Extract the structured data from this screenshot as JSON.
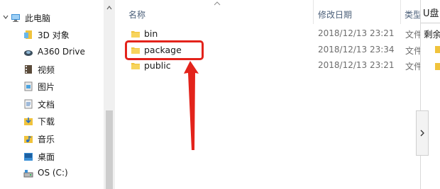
{
  "nav": {
    "items": [
      {
        "label": "此电脑",
        "icon": "computer-icon"
      },
      {
        "label": "3D 对象",
        "icon": "3d-objects-icon"
      },
      {
        "label": "A360 Drive",
        "icon": "cloud-drive-icon"
      },
      {
        "label": "视频",
        "icon": "video-folder-icon"
      },
      {
        "label": "图片",
        "icon": "pictures-folder-icon"
      },
      {
        "label": "文档",
        "icon": "documents-folder-icon"
      },
      {
        "label": "下载",
        "icon": "downloads-folder-icon"
      },
      {
        "label": "音乐",
        "icon": "music-folder-icon"
      },
      {
        "label": "桌面",
        "icon": "desktop-folder-icon"
      },
      {
        "label": "OS (C:)",
        "icon": "drive-icon"
      }
    ]
  },
  "columns": {
    "name": "名称",
    "date": "修改日期",
    "type": "类型"
  },
  "files": [
    {
      "name": "bin",
      "date": "2018/12/13 23:21",
      "type": "文件夹"
    },
    {
      "name": "package",
      "date": "2018/12/13 23:34",
      "type": "文件夹"
    },
    {
      "name": "public",
      "date": "2018/12/13 23:21",
      "type": "文件夹"
    }
  ],
  "panel": {
    "title": "U盘",
    "free_label": "剩余"
  },
  "colors": {
    "highlight": "#e3231b",
    "folder": "#f0c33c",
    "header_text": "#4c607a"
  }
}
